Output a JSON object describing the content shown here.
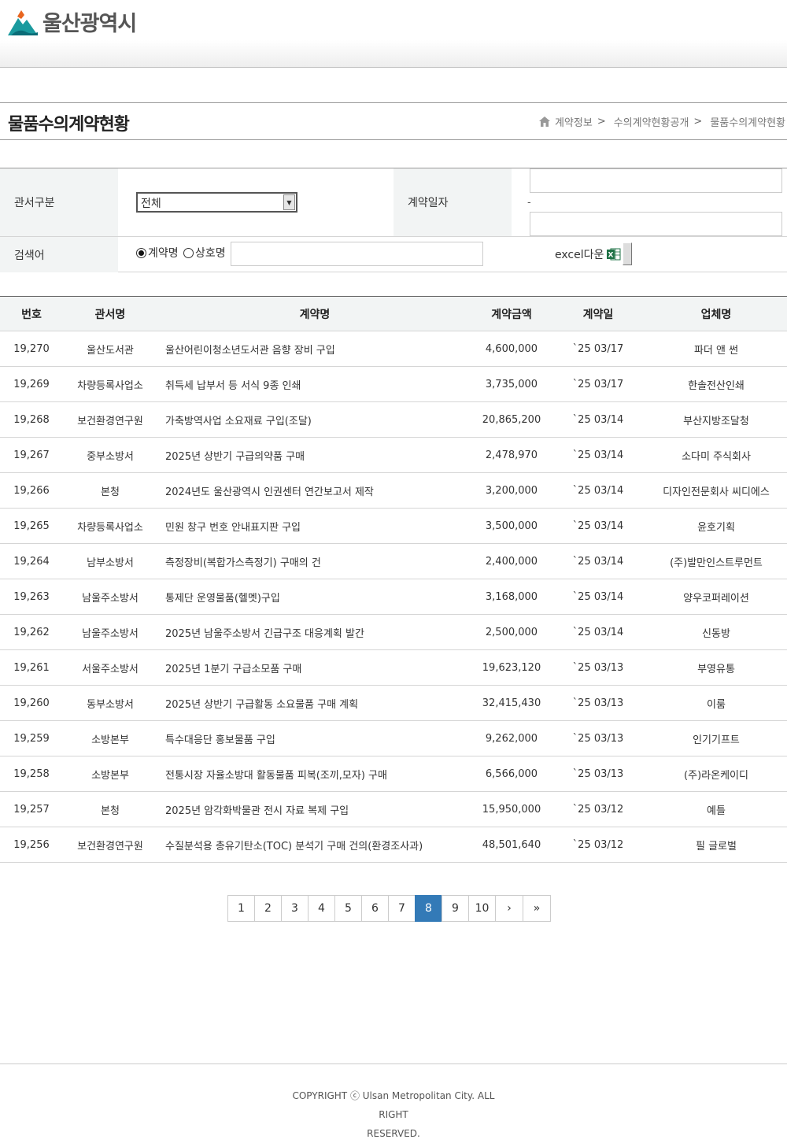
{
  "header": {
    "logo_text": "울산광역시",
    "logo_icon": "ulsan-mountain-logo-icon"
  },
  "title_bar": {
    "title": "물품수의계약현황",
    "breadcrumb": [
      {
        "label": "계약정보",
        "sep": ">"
      },
      {
        "label": "수의계약현황공개",
        "sep": ">"
      },
      {
        "label": "물품수의계약현황",
        "sep": ""
      }
    ]
  },
  "search": {
    "dept_label": "관서구분",
    "dept_selected": "전체",
    "date_label": "계약일자",
    "date_separator": "-",
    "keyword_label": "검색어",
    "radio_contract": "계약명",
    "radio_company": "상호명",
    "excel_label": "excel다운"
  },
  "table": {
    "headers": [
      "번호",
      "관서명",
      "계약명",
      "계약금액",
      "계약일",
      "업체명"
    ],
    "rows": [
      [
        "19,270",
        "울산도서관",
        "울산어린이청소년도서관 음향 장비 구입",
        "4,600,000",
        "`25 03/17",
        "파더 앤 썬"
      ],
      [
        "19,269",
        "차량등록사업소",
        "취득세 납부서 등 서식 9종 인쇄",
        "3,735,000",
        "`25 03/17",
        "한솔전산인쇄"
      ],
      [
        "19,268",
        "보건환경연구원",
        "가축방역사업 소요재료 구입(조달)",
        "20,865,200",
        "`25 03/14",
        "부산지방조달청"
      ],
      [
        "19,267",
        "중부소방서",
        "2025년 상반기 구급의약품 구매",
        "2,478,970",
        "`25 03/14",
        "소다미 주식회사"
      ],
      [
        "19,266",
        "본청",
        "2024년도 울산광역시 인권센터 연간보고서 제작",
        "3,200,000",
        "`25 03/14",
        "디자인전문회사 씨디에스"
      ],
      [
        "19,265",
        "차량등록사업소",
        "민원 창구 번호 안내표지판 구입",
        "3,500,000",
        "`25 03/14",
        "윤호기획"
      ],
      [
        "19,264",
        "남부소방서",
        "측정장비(복합가스측정기) 구매의 건",
        "2,400,000",
        "`25 03/14",
        "(주)발만인스트루먼트"
      ],
      [
        "19,263",
        "남울주소방서",
        "통제단 운영물품(헬멧)구입",
        "3,168,000",
        "`25 03/14",
        "양우코퍼레이션"
      ],
      [
        "19,262",
        "남울주소방서",
        "2025년 남울주소방서 긴급구조 대응계획 발간",
        "2,500,000",
        "`25 03/14",
        "신동방"
      ],
      [
        "19,261",
        "서울주소방서",
        "2025년 1분기 구급소모품 구매",
        "19,623,120",
        "`25 03/13",
        "부영유통"
      ],
      [
        "19,260",
        "동부소방서",
        "2025년 상반기 구급활동 소요물품 구매 계획",
        "32,415,430",
        "`25 03/13",
        "이룸"
      ],
      [
        "19,259",
        "소방본부",
        "특수대응단 홍보물품 구입",
        "9,262,000",
        "`25 03/13",
        "인기기프트"
      ],
      [
        "19,258",
        "소방본부",
        "전통시장 자율소방대 활동물품 피복(조끼,모자) 구매",
        "6,566,000",
        "`25 03/13",
        "(주)라온케이디"
      ],
      [
        "19,257",
        "본청",
        "2025년 암각화박물관 전시 자료 복제 구입",
        "15,950,000",
        "`25 03/12",
        "예틀"
      ],
      [
        "19,256",
        "보건환경연구원",
        "수질분석용 총유기탄소(TOC) 분석기 구매 건의(환경조사과)",
        "48,501,640",
        "`25 03/12",
        "필 글로벌"
      ]
    ]
  },
  "pagination": {
    "pages": [
      "1",
      "2",
      "3",
      "4",
      "5",
      "6",
      "7",
      "8",
      "9",
      "10"
    ],
    "current": "8",
    "next": "›",
    "last": "»"
  },
  "footer": {
    "copyright_line1": "COPYRIGHT ⓒ Ulsan Metropolitan City. ALL RIGHT",
    "copyright_line2": "RESERVED."
  },
  "colors": {
    "accent": "#337ab7",
    "header_cell_bg": "#f2f4f4",
    "logo_teal": "#1a9a9e"
  }
}
